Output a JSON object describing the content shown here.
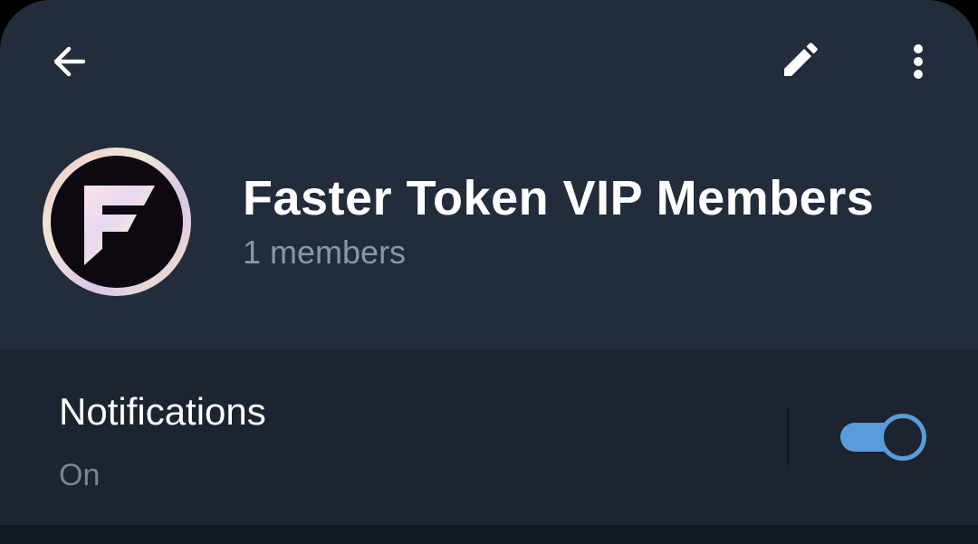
{
  "header": {
    "title": "Faster Token VIP Members",
    "subtitle": "1 members",
    "icons": {
      "back": "arrow-back-icon",
      "edit": "pencil-icon",
      "more": "more-vertical-icon"
    },
    "avatar_letter": "F"
  },
  "notifications": {
    "label": "Notifications",
    "status": "On",
    "enabled": true
  },
  "colors": {
    "header_bg": "#222c3a",
    "row_bg": "#1b2430",
    "accent": "#5a9bd9",
    "subtitle": "#8a97a6"
  }
}
